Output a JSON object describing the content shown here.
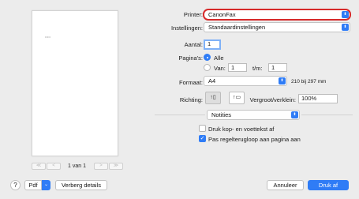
{
  "preview": {
    "paper_mark": "•••••",
    "page_label": "1 van 1",
    "nav": {
      "first": "≪",
      "prev": "<",
      "next": ">",
      "last": "≫"
    }
  },
  "printer": {
    "label": "Printer:",
    "value": "CanonFax"
  },
  "presets": {
    "label": "Instellingen:",
    "value": "Standaardinstellingen"
  },
  "copies": {
    "label": "Aantal:",
    "value": "1"
  },
  "pages": {
    "label": "Pagina's:",
    "all_label": "Alle",
    "range_label": "Van:",
    "from_value": "1",
    "to_label": "t/m:",
    "to_value": "1"
  },
  "format": {
    "label": "Formaat:",
    "value": "A4",
    "size_text": "210 bij 297 mm"
  },
  "orientation": {
    "label": "Richting:",
    "portrait_glyph": "↑▯",
    "landscape_glyph": "↑▭"
  },
  "scale": {
    "label": "Vergroot/verklein:",
    "value": "100%"
  },
  "section": {
    "value": "Notities"
  },
  "options": {
    "header_footer_label": "Druk kop- en voettekst af",
    "header_footer_checked": false,
    "fit_lines_label": "Pas regelterugloop aan pagina aan",
    "fit_lines_checked": true
  },
  "bottom": {
    "help": "?",
    "pdf": "Pdf",
    "pdf_arrow": "⌄",
    "details": "Verberg details",
    "cancel": "Annuleer",
    "print": "Druk af"
  },
  "icons": {
    "popup_arrows": "⬍",
    "check": "✓"
  },
  "colors": {
    "accent": "#2f7cf6",
    "highlight_ring": "#d72a2a"
  }
}
